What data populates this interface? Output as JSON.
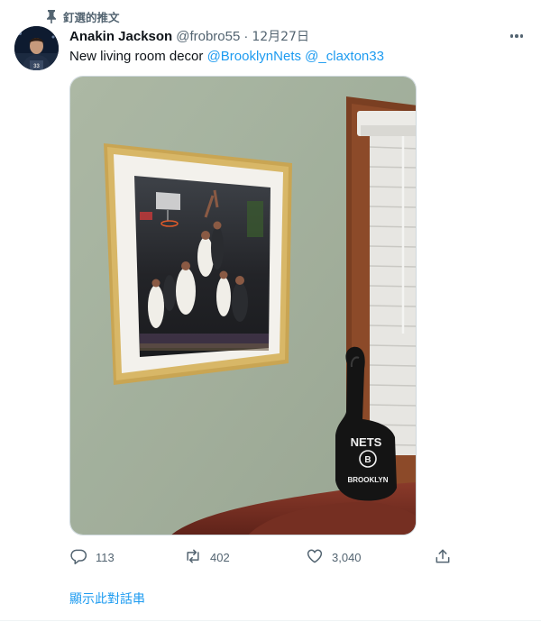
{
  "pinned": {
    "label": "釘選的推文",
    "icon": "pin-icon"
  },
  "author": {
    "name": "Anakin Jackson",
    "handle": "@frobro55",
    "separator": "·",
    "date": "12月27日",
    "avatar_icon": "avatar-photo"
  },
  "tweet": {
    "text_prefix": "New living room decor ",
    "mentions": [
      "@BrooklynNets",
      "@_claxton33"
    ]
  },
  "media": {
    "foam_finger_text_top": "NETS",
    "foam_finger_text_bottom": "BROOKLYN",
    "foam_finger_logo_letter": "B"
  },
  "actions": {
    "reply_count": "113",
    "retweet_count": "402",
    "like_count": "3,040",
    "reply_icon": "reply-icon",
    "retweet_icon": "retweet-icon",
    "like_icon": "heart-icon",
    "share_icon": "share-icon"
  },
  "thread_link": "顯示此對話串",
  "colors": {
    "accent": "#1d9bf0",
    "muted": "#536471",
    "text": "#0f1419"
  }
}
